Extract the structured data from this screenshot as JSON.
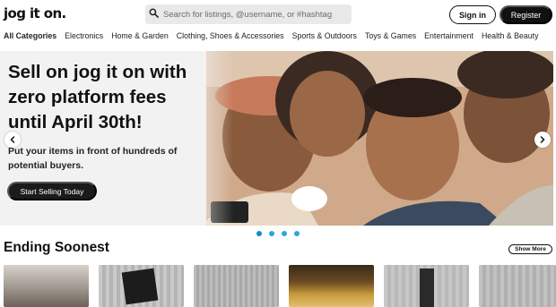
{
  "brand": {
    "logo_text": "jog it on."
  },
  "search": {
    "placeholder": "Search for listings, @username, or #hashtag",
    "icon": "search-icon"
  },
  "header": {
    "signin_label": "Sign in",
    "register_label": "Register"
  },
  "categories": [
    {
      "label": "All Categories",
      "active": true
    },
    {
      "label": "Electronics",
      "active": false
    },
    {
      "label": "Home & Garden",
      "active": false
    },
    {
      "label": "Clothing, Shoes & Accessories",
      "active": false
    },
    {
      "label": "Sports & Outdoors",
      "active": false
    },
    {
      "label": "Toys & Games",
      "active": false
    },
    {
      "label": "Entertainment",
      "active": false
    },
    {
      "label": "Health & Beauty",
      "active": false
    }
  ],
  "hero": {
    "title": "Sell on jog it on with zero platform fees until April 30th!",
    "subtitle": "Put your items in front of hundreds of potential buyers.",
    "cta_label": "Start Selling Today",
    "prev_icon": "chevron-left-icon",
    "next_icon": "chevron-right-icon",
    "slides_count": 4,
    "active_slide": 1
  },
  "ending_soonest": {
    "title": "Ending Soonest",
    "show_more_label": "Show More"
  },
  "colors": {
    "accent_dots": "#2aa8d8",
    "dark_button": "#111111",
    "search_bg": "#e9e9e9"
  }
}
